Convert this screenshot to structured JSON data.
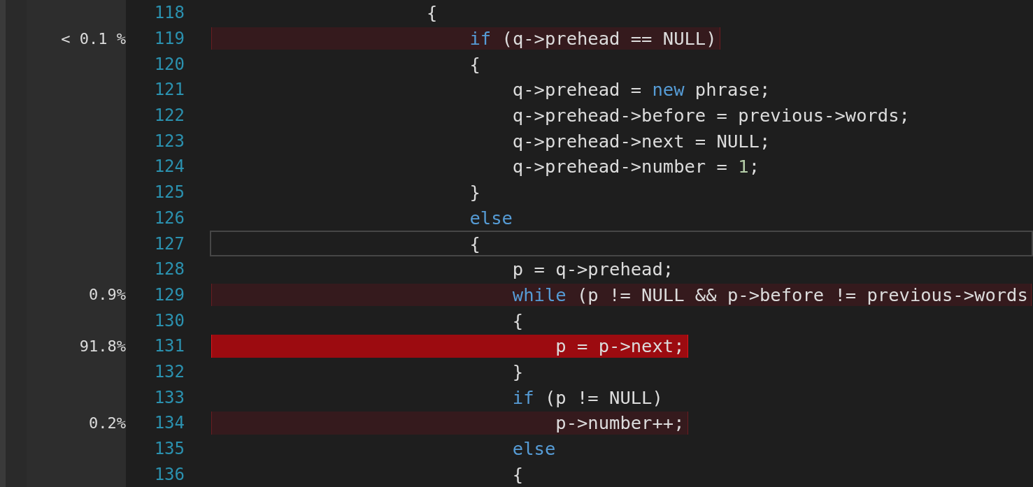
{
  "lines": [
    {
      "number": "118",
      "hot": false,
      "current": false,
      "tokens": [
        {
          "text": "                    {",
          "kind": "plain"
        }
      ]
    },
    {
      "number": "119",
      "percent": "< 0.1 %",
      "hot": false,
      "current": false,
      "tokens": [
        {
          "text": "                        if",
          "kind": "keyword"
        },
        {
          "text": " (q->prehead == NULL)",
          "kind": "plain"
        }
      ]
    },
    {
      "number": "120",
      "hot": false,
      "current": false,
      "tokens": [
        {
          "text": "                        {",
          "kind": "plain"
        }
      ]
    },
    {
      "number": "121",
      "hot": false,
      "current": false,
      "tokens": [
        {
          "text": "                            q->prehead = ",
          "kind": "plain"
        },
        {
          "text": "new",
          "kind": "keyword"
        },
        {
          "text": " phrase;",
          "kind": "plain"
        }
      ]
    },
    {
      "number": "122",
      "hot": false,
      "current": false,
      "tokens": [
        {
          "text": "                            q->prehead->before = previous->words;",
          "kind": "plain"
        }
      ]
    },
    {
      "number": "123",
      "hot": false,
      "current": false,
      "tokens": [
        {
          "text": "                            q->prehead->next = NULL;",
          "kind": "plain"
        }
      ]
    },
    {
      "number": "124",
      "hot": false,
      "current": false,
      "tokens": [
        {
          "text": "                            q->prehead->number = ",
          "kind": "plain"
        },
        {
          "text": "1",
          "kind": "number"
        },
        {
          "text": ";",
          "kind": "plain"
        }
      ]
    },
    {
      "number": "125",
      "hot": false,
      "current": false,
      "tokens": [
        {
          "text": "                        }",
          "kind": "plain"
        }
      ]
    },
    {
      "number": "126",
      "hot": false,
      "current": false,
      "tokens": [
        {
          "text": "                        else",
          "kind": "keyword"
        }
      ]
    },
    {
      "number": "127",
      "hot": false,
      "current": true,
      "tokens": [
        {
          "text": "                        {",
          "kind": "plain"
        }
      ]
    },
    {
      "number": "128",
      "hot": false,
      "current": false,
      "tokens": [
        {
          "text": "                            p = q->prehead;",
          "kind": "plain"
        }
      ]
    },
    {
      "number": "129",
      "percent": "0.9%",
      "hot": false,
      "current": false,
      "tokens": [
        {
          "text": "                            while",
          "kind": "keyword"
        },
        {
          "text": " (p != NULL && p->before != previous->words",
          "kind": "plain"
        }
      ]
    },
    {
      "number": "130",
      "hot": false,
      "current": false,
      "tokens": [
        {
          "text": "                            {",
          "kind": "plain"
        }
      ]
    },
    {
      "number": "131",
      "percent": "91.8%",
      "hot": true,
      "current": false,
      "tokens": [
        {
          "text": "                                p = p->next;",
          "kind": "plain"
        }
      ]
    },
    {
      "number": "132",
      "hot": false,
      "current": false,
      "tokens": [
        {
          "text": "                            }",
          "kind": "plain"
        }
      ]
    },
    {
      "number": "133",
      "hot": false,
      "current": false,
      "tokens": [
        {
          "text": "                            if",
          "kind": "keyword"
        },
        {
          "text": " (p != NULL)",
          "kind": "plain"
        }
      ]
    },
    {
      "number": "134",
      "percent": "0.2%",
      "hot": false,
      "current": false,
      "tokens": [
        {
          "text": "                                p->number++;",
          "kind": "plain"
        }
      ]
    },
    {
      "number": "135",
      "hot": false,
      "current": false,
      "tokens": [
        {
          "text": "                            else",
          "kind": "keyword"
        }
      ]
    },
    {
      "number": "136",
      "hot": false,
      "current": false,
      "tokens": [
        {
          "text": "                            {",
          "kind": "plain"
        }
      ]
    }
  ]
}
